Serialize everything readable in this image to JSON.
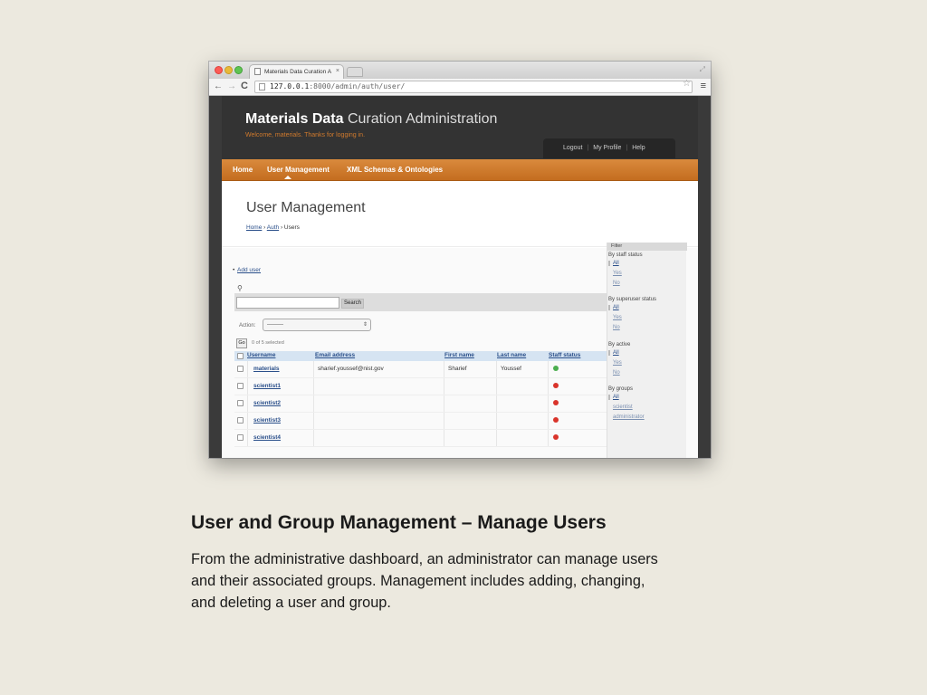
{
  "browser": {
    "tab_title": "Materials Data Curation A",
    "tab_close": "×",
    "url_host": "127.0.0.1",
    "url_rest": ":8000/admin/auth/user/"
  },
  "admin": {
    "site_title_bold": "Materials Data",
    "site_title_rest": " Curation Administration",
    "welcome": "Welcome, materials. Thanks for logging in.",
    "user_tools": [
      "Logout",
      "My Profile",
      "Help"
    ],
    "nav": [
      "Home",
      "User Management",
      "XML Schemas & Ontologies"
    ],
    "page_title": "User Management",
    "breadcrumb": {
      "home": "Home",
      "sep1": " › ",
      "auth": "Auth",
      "sep2": " › ",
      "current": "Users"
    },
    "add_user": "Add user",
    "search_button": "Search",
    "action_label": "Action:",
    "action_value": "---------",
    "go_button": "Go",
    "selected_count": "0 of 5 selected",
    "columns": [
      "Username",
      "Email address",
      "First name",
      "Last name",
      "Staff status"
    ],
    "rows": [
      {
        "username": "materials",
        "email": "sharief.youssef@nist.gov",
        "first": "Sharief",
        "last": "Youssef",
        "staff": true
      },
      {
        "username": "scientist1",
        "email": "",
        "first": "",
        "last": "",
        "staff": false
      },
      {
        "username": "scientist2",
        "email": "",
        "first": "",
        "last": "",
        "staff": false
      },
      {
        "username": "scientist3",
        "email": "",
        "first": "",
        "last": "",
        "staff": false
      },
      {
        "username": "scientist4",
        "email": "",
        "first": "",
        "last": "",
        "staff": false
      }
    ],
    "filter": {
      "title": "Filter",
      "staff_heading": "By staff status",
      "superuser_heading": "By superuser status",
      "active_heading": "By active",
      "groups_heading": "By groups",
      "options_all": "All",
      "options_yes": "Yes",
      "options_no": "No",
      "groups": [
        "scientist",
        "administrator"
      ]
    },
    "colors": {
      "header": "#333333",
      "nav_orange": "#c46d1f",
      "welcome": "#d07a2d",
      "link": "#2a4f8a",
      "status_yes": "#4bae4f",
      "status_no": "#d9342b"
    }
  },
  "slide": {
    "title": "User and Group Management – Manage Users",
    "body_lines": [
      "From the administrative dashboard, an administrator can manage users",
      "and their associated groups.  Management includes adding, changing,",
      "and deleting a user and group."
    ]
  }
}
